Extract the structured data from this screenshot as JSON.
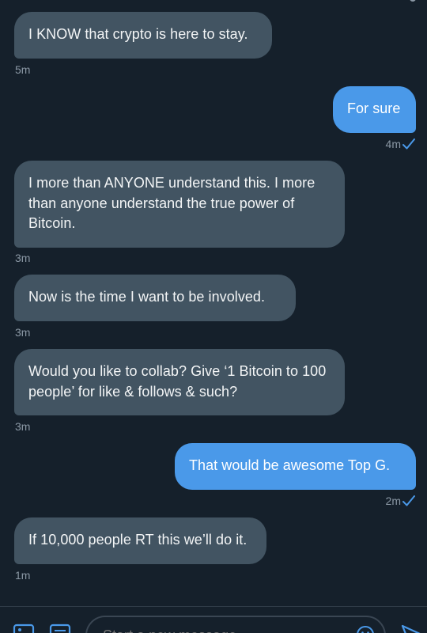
{
  "messages": [
    {
      "direction": "incoming",
      "text": "I KNOW that crypto is here to stay.",
      "time": "5m"
    },
    {
      "direction": "outgoing",
      "text": "For sure",
      "time": "4m",
      "read": true
    },
    {
      "direction": "incoming",
      "text": "I more than ANYONE understand this. I more than anyone understand the true power of Bitcoin.",
      "time": "3m"
    },
    {
      "direction": "incoming",
      "text": "Now is the time I want to be involved.",
      "time": "3m"
    },
    {
      "direction": "incoming",
      "text": "Would you like to collab? Give ‘1 Bitcoin to 100 people’ for like & follows & such?",
      "time": "3m"
    },
    {
      "direction": "outgoing",
      "text": "That would be awesome Top G.",
      "time": "2m",
      "read": true
    },
    {
      "direction": "incoming",
      "text": "If 10,000 people RT this we’ll do it.",
      "time": "1m"
    }
  ],
  "composer": {
    "placeholder": "Start a new message"
  },
  "icons": {
    "media": "image-icon",
    "gif": "gif-icon",
    "emoji": "emoji-icon",
    "send": "send-icon",
    "read_receipt": "check-icon"
  },
  "colors": {
    "background": "#15202b",
    "incoming_bubble": "#425462",
    "outgoing_bubble": "#4a99e9",
    "meta_text": "#8b98a5",
    "accent": "#4a99e9"
  }
}
